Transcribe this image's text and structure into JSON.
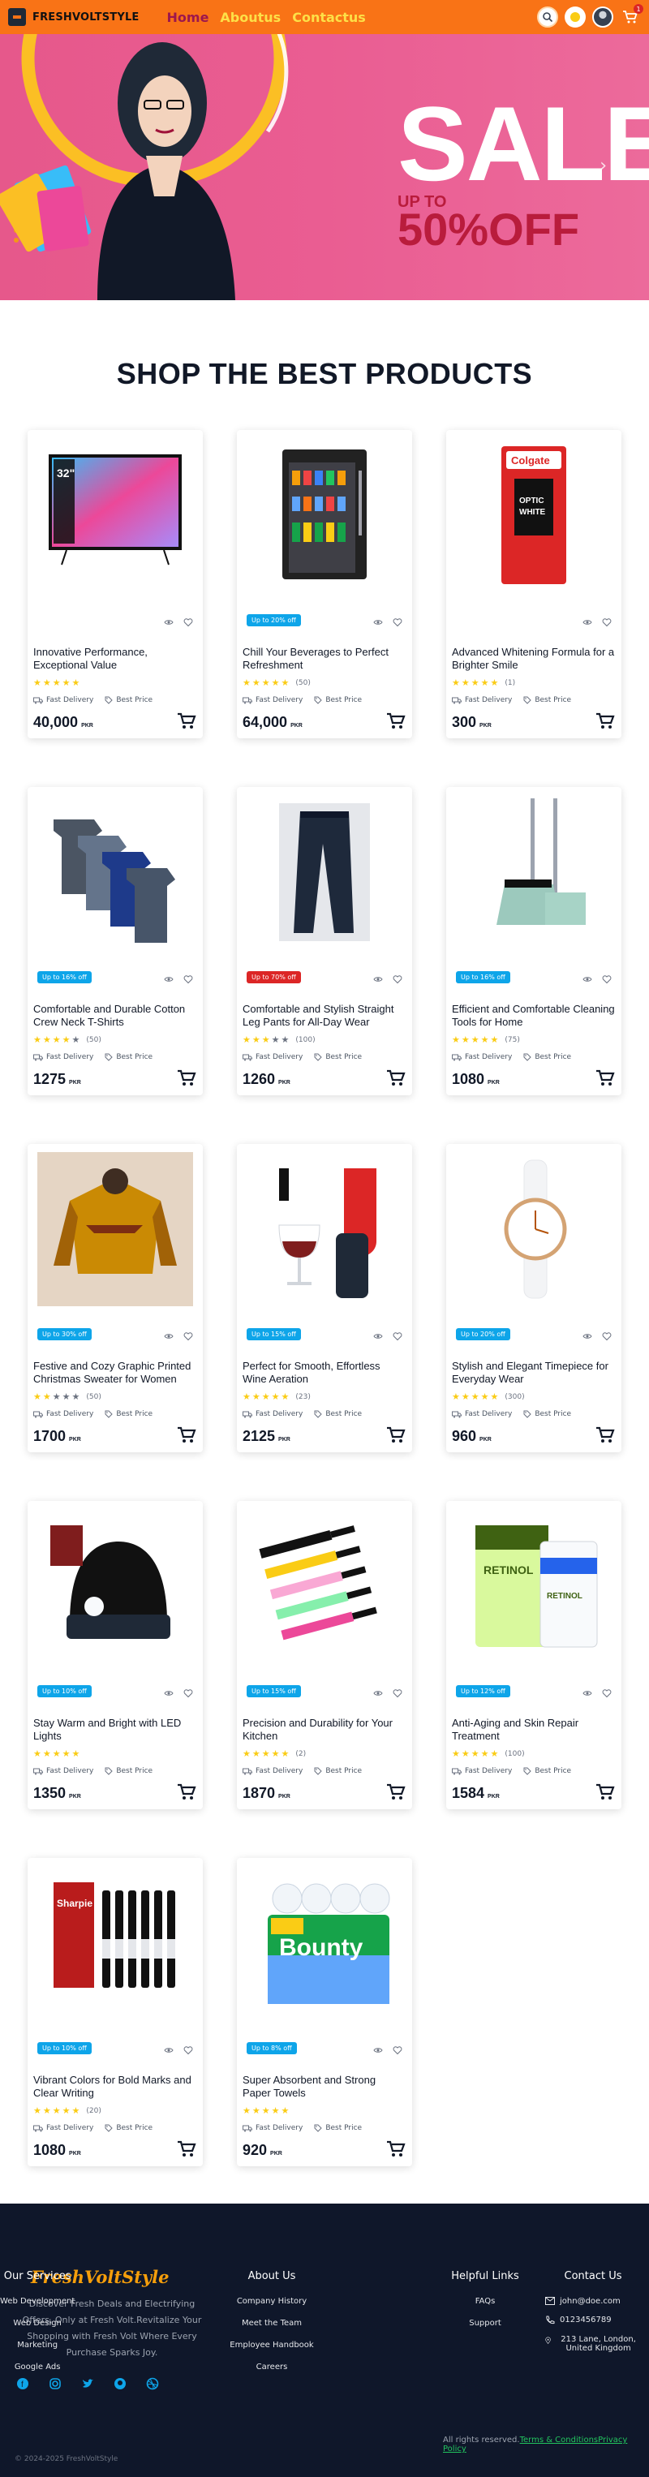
{
  "nav": {
    "brand": "FRESHVOLTSTYLE",
    "links": [
      "Home",
      "Aboutus",
      "Contactus"
    ],
    "cart_count": "1"
  },
  "hero": {
    "sale": "SALE",
    "upto": "UP TO",
    "off": "50%OFF"
  },
  "section_title": "SHOP THE BEST PRODUCTS",
  "labels": {
    "fast_delivery": "Fast Delivery",
    "best_price": "Best Price",
    "currency": "PKR"
  },
  "products": [
    {
      "title": "Innovative Performance, Exceptional Value",
      "badge": "",
      "rating": 5,
      "count": "",
      "price": "40,000",
      "img": "tv"
    },
    {
      "title": "Chill Your Beverages to Perfect Refreshment",
      "badge": "Up to 20% off",
      "rating": 5,
      "count": "(50)",
      "price": "64,000",
      "img": "fridge"
    },
    {
      "title": "Advanced Whitening Formula for a Brighter Smile",
      "badge": "",
      "rating": 5,
      "count": "(1)",
      "price": "300",
      "img": "toothpaste"
    },
    {
      "title": "Comfortable and Durable Cotton Crew Neck T-Shirts",
      "badge": "Up to 16% off",
      "rating": 4,
      "count": "(50)",
      "price": "1275",
      "img": "tshirts"
    },
    {
      "title": "Comfortable and Stylish Straight Leg Pants for All-Day Wear",
      "badge": "Up to 70% off",
      "badge_red": true,
      "rating": 3,
      "count": "(100)",
      "price": "1260",
      "img": "pants"
    },
    {
      "title": "Efficient and Comfortable Cleaning Tools for Home",
      "badge": "Up to 16% off",
      "rating": 5,
      "count": "(75)",
      "price": "1080",
      "img": "broom"
    },
    {
      "title": "Festive and Cozy Graphic Printed Christmas Sweater for Women",
      "badge": "Up to 30% off",
      "rating": 2,
      "count": "(50)",
      "price": "1700",
      "img": "sweater"
    },
    {
      "title": "Perfect for Smooth, Effortless Wine Aeration",
      "badge": "Up to 15% off",
      "rating": 5,
      "count": "(23)",
      "price": "2125",
      "img": "wine"
    },
    {
      "title": "Stylish and Elegant Timepiece for Everyday Wear",
      "badge": "Up to 20% off",
      "rating": 5,
      "count": "(300)",
      "price": "960",
      "img": "watch"
    },
    {
      "title": "Stay Warm and Bright with LED Lights",
      "badge": "Up to 10% off",
      "rating": 5,
      "count": "",
      "price": "1350",
      "img": "beanie"
    },
    {
      "title": "Precision and Durability for Your Kitchen",
      "badge": "Up to 15% off",
      "rating": 5,
      "count": "(2)",
      "price": "1870",
      "img": "knives"
    },
    {
      "title": "Anti-Aging and Skin Repair Treatment",
      "badge": "Up to 12% off",
      "rating": 5,
      "count": "(100)",
      "price": "1584",
      "img": "retinol"
    },
    {
      "title": "Vibrant Colors for Bold Marks and Clear Writing",
      "badge": "Up to 10% off",
      "rating": 5,
      "count": "(20)",
      "price": "1080",
      "img": "markers"
    },
    {
      "title": "Super Absorbent and Strong Paper Towels",
      "badge": "Up to 8% off",
      "rating": 5,
      "count": "",
      "price": "920",
      "img": "towels"
    }
  ],
  "footer": {
    "brand": "FreshVoltStyle",
    "description": "Discover Fresh Deals and Electrifying Offers, Only at Fresh Volt.Revitalize Your Shopping with Fresh Volt Where Every Purchase Sparks Joy.",
    "columns": [
      {
        "title": "About Us",
        "links": [
          "Company History",
          "Meet the Team",
          "Employee Handbook",
          "Careers"
        ]
      },
      {
        "title": "Our Services",
        "links": [
          "Web Development",
          "Web Design",
          "Marketing",
          "Google Ads"
        ]
      },
      {
        "title": "Helpful Links",
        "links": [
          "FAQs",
          "Support"
        ]
      }
    ],
    "contact_title": "Contact Us",
    "email": "john@doe.com",
    "phone": "0123456789",
    "address": "213 Lane, London, United Kingdom",
    "copyright": "© 2024-2025 FreshVoltStyle",
    "rights": "All rights reserved.",
    "terms": "Terms & Conditions",
    "privacy": "Privacy Policy"
  }
}
